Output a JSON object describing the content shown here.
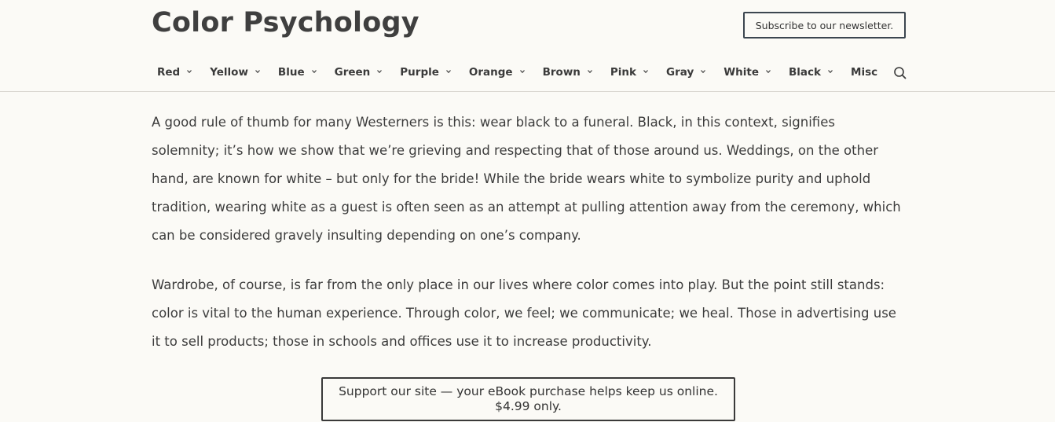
{
  "header": {
    "site_title": "Color Psychology",
    "subscribe_label": "Subscribe to our newsletter."
  },
  "nav": {
    "items": [
      {
        "label": "Red"
      },
      {
        "label": "Yellow"
      },
      {
        "label": "Blue"
      },
      {
        "label": "Green"
      },
      {
        "label": "Purple"
      },
      {
        "label": "Orange"
      },
      {
        "label": "Brown"
      },
      {
        "label": "Pink"
      },
      {
        "label": "Gray"
      },
      {
        "label": "White"
      },
      {
        "label": "Black"
      },
      {
        "label": "Misc"
      }
    ],
    "search_icon": "search-icon",
    "chevron_icon": "chevron-down-icon"
  },
  "article": {
    "paragraph_1": "A good rule of thumb for many Westerners is this: wear black to a funeral. Black, in this context, signifies solemnity; it’s how we show that we’re grieving and respecting that of those around us. Weddings, on the other hand, are known for white – but only for the bride! While the bride wears white to symbolize purity and uphold tradition, wearing white as a guest is often seen as an attempt at pulling attention away from the ceremony, which can be considered gravely insulting depending on one’s company.",
    "paragraph_2": "Wardrobe, of course, is far from the only place in our lives where color comes into play. But the point still stands: color is vital to the human experience. Through color, we feel; we communicate; we heal. Those in advertising use it to sell products; those in schools and offices use it to increase productivity."
  },
  "ebook_banner": {
    "line_1": "Support our site — your eBook purchase helps keep us online.",
    "line_2": "$4.99 only."
  },
  "colors": {
    "background": "#fbfaf6",
    "text": "#3c3c3c",
    "border": "#3c4650",
    "divider": "#d9d6cf"
  }
}
